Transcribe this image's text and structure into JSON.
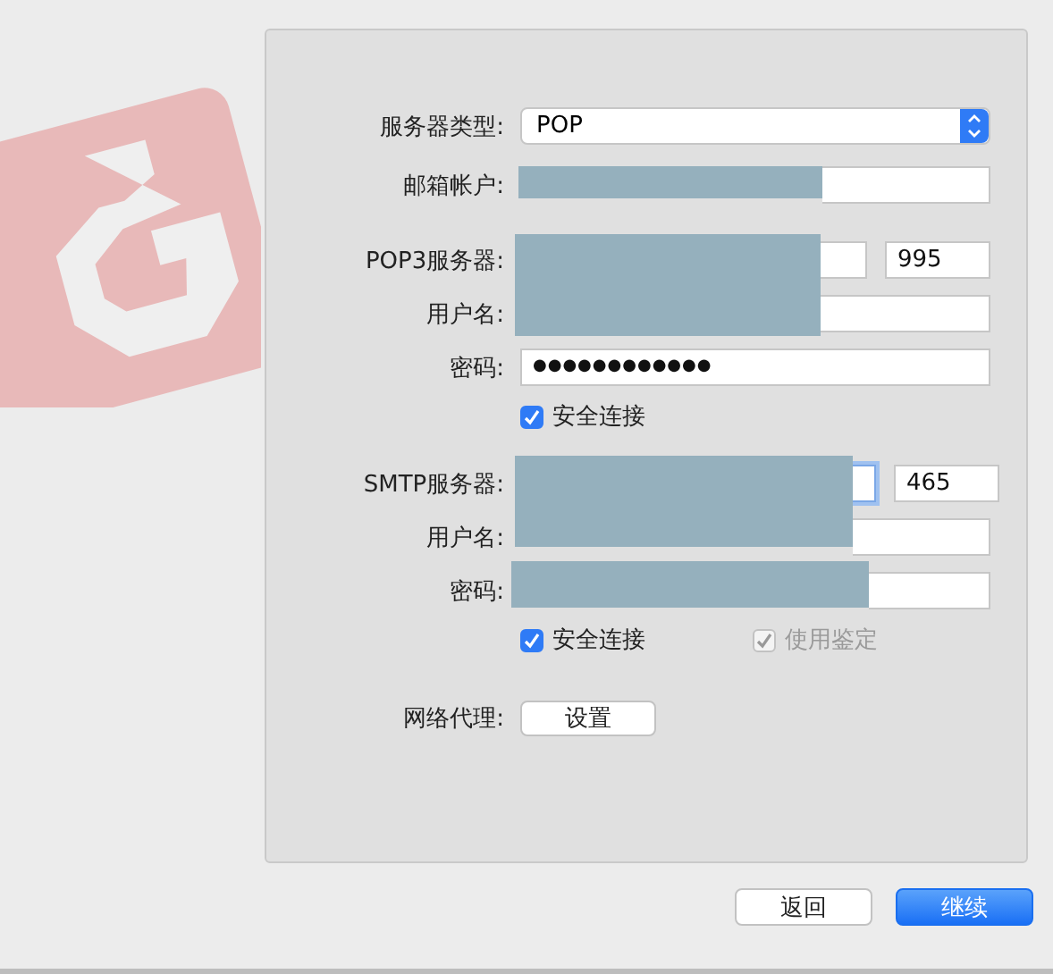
{
  "server_type": {
    "label": "服务器类型:",
    "value": "POP"
  },
  "account": {
    "label": "邮箱帐户:",
    "redacted": true
  },
  "incoming": {
    "server": {
      "label": "POP3服务器:",
      "port": "995",
      "focused": false
    },
    "username": {
      "label": "用户名:"
    },
    "password": {
      "label": "密码:",
      "value": "●●●●●●●●●●●●"
    },
    "options": [
      {
        "label": "安全连接",
        "checked": true,
        "disabled": false
      }
    ]
  },
  "outgoing": {
    "server": {
      "label": "SMTP服务器:",
      "port": "465",
      "focused": true
    },
    "username": {
      "label": "用户名:"
    },
    "password": {
      "label": "密码:"
    },
    "options": [
      {
        "label": "安全连接",
        "checked": true,
        "disabled": false
      },
      {
        "label": "使用鉴定",
        "checked": true,
        "disabled": true
      }
    ]
  },
  "proxy": {
    "label": "网络代理:",
    "button": "设置"
  },
  "buttons": [
    {
      "label": "返回",
      "kind": "secondary"
    },
    {
      "label": "继续",
      "kind": "primary"
    }
  ]
}
